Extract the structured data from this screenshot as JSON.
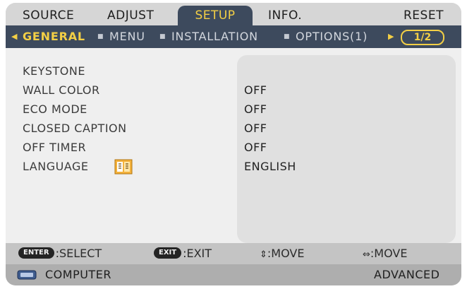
{
  "tabs": [
    {
      "label": "SOURCE",
      "active": false
    },
    {
      "label": "ADJUST",
      "active": false
    },
    {
      "label": "SETUP",
      "active": true
    },
    {
      "label": "INFO.",
      "active": false
    },
    {
      "label": "RESET",
      "active": false
    }
  ],
  "subtabs": [
    {
      "label": "GENERAL",
      "active": true
    },
    {
      "label": "MENU",
      "active": false
    },
    {
      "label": "INSTALLATION",
      "active": false
    },
    {
      "label": "OPTIONS(1)",
      "active": false
    }
  ],
  "page_indicator": "1/2",
  "settings": [
    {
      "label": "KEYSTONE",
      "value": ""
    },
    {
      "label": "WALL COLOR",
      "value": "OFF"
    },
    {
      "label": "ECO MODE",
      "value": "OFF"
    },
    {
      "label": "CLOSED CAPTION",
      "value": "OFF"
    },
    {
      "label": "OFF TIMER",
      "value": "OFF"
    },
    {
      "label": "LANGUAGE",
      "value": "ENGLISH"
    }
  ],
  "language_icon": "language-icon",
  "hints": [
    {
      "key": "ENTER",
      "text": ":SELECT"
    },
    {
      "key": "EXIT",
      "text": ":EXIT"
    },
    {
      "glyph": "⇕",
      "text": ":MOVE"
    },
    {
      "glyph": "⇔",
      "text": ":MOVE"
    }
  ],
  "source": {
    "icon": "monitor-icon",
    "label": "COMPUTER",
    "mode": "ADVANCED"
  },
  "colors": {
    "active_tab_bg": "#3d4a5d",
    "highlight": "#f3cf45"
  }
}
